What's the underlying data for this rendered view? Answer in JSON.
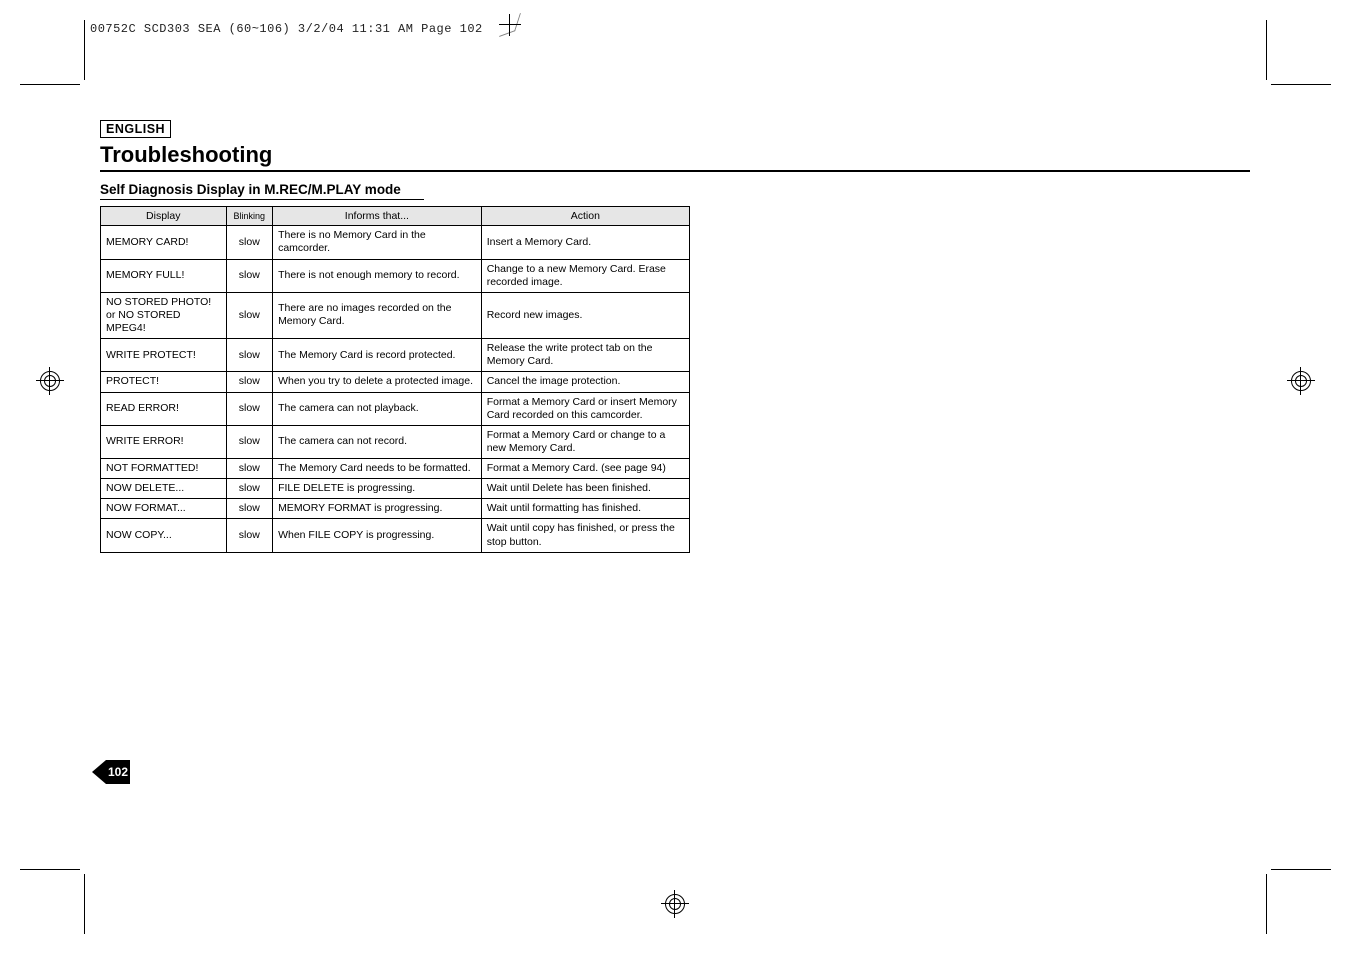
{
  "header_slug": "00752C SCD303 SEA (60~106)  3/2/04 11:31 AM  Page 102",
  "lang_box": "ENGLISH",
  "section_title": "Troubleshooting",
  "subheading": "Self Diagnosis Display in M.REC/M.PLAY mode",
  "page_number": "102",
  "table": {
    "headers": {
      "display": "Display",
      "blinking": "Blinking",
      "informs": "Informs that...",
      "action": "Action"
    },
    "rows": [
      {
        "display": "MEMORY CARD!",
        "blinking": "slow",
        "informs": "There is no Memory Card in the camcorder.",
        "action": "Insert a Memory Card."
      },
      {
        "display": "MEMORY FULL!",
        "blinking": "slow",
        "informs": "There is not enough memory to record.",
        "action": "Change to a new Memory Card. Erase recorded image."
      },
      {
        "display": "NO STORED PHOTO! or NO STORED MPEG4!",
        "blinking": "slow",
        "informs": "There are no images recorded on the Memory Card.",
        "action": "Record new images."
      },
      {
        "display": "WRITE PROTECT!",
        "blinking": "slow",
        "informs": "The Memory Card is record protected.",
        "action": "Release the write protect tab on the Memory Card."
      },
      {
        "display": "PROTECT!",
        "blinking": "slow",
        "informs": "When you try to delete a protected image.",
        "action": "Cancel the image protection."
      },
      {
        "display": "READ ERROR!",
        "blinking": "slow",
        "informs": "The camera can not playback.",
        "action": "Format a Memory Card or insert Memory Card recorded on this camcorder."
      },
      {
        "display": "WRITE ERROR!",
        "blinking": "slow",
        "informs": "The camera can not record.",
        "action": "Format a Memory Card or change to a new Memory Card."
      },
      {
        "display": "NOT FORMATTED!",
        "blinking": "slow",
        "informs": "The Memory Card needs to be formatted.",
        "action": "Format a Memory Card. (see page 94)"
      },
      {
        "display": "NOW DELETE...",
        "blinking": "slow",
        "informs": "FILE DELETE is progressing.",
        "action": "Wait until Delete has been finished."
      },
      {
        "display": "NOW FORMAT...",
        "blinking": "slow",
        "informs": "MEMORY FORMAT is progressing.",
        "action": "Wait until formatting has finished."
      },
      {
        "display": "NOW COPY...",
        "blinking": "slow",
        "informs": "When FILE COPY is progressing.",
        "action": "Wait until copy has finished, or press the stop button."
      }
    ]
  }
}
